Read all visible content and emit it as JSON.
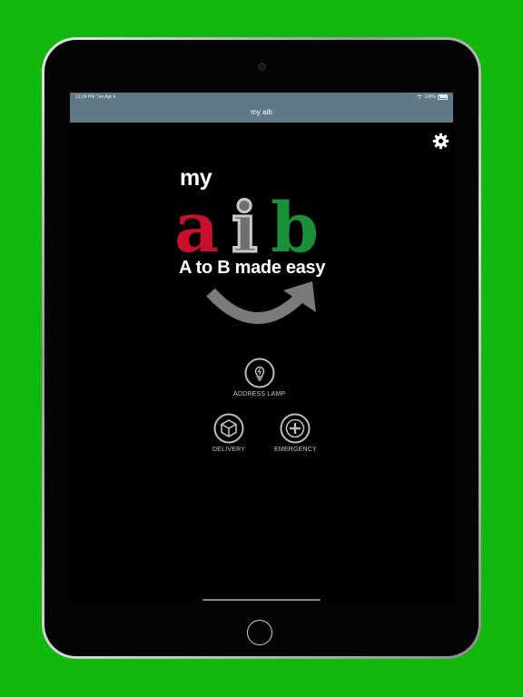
{
  "status_bar": {
    "time": "12:24 PM",
    "date": "Tue Apr 4",
    "battery": "100%"
  },
  "nav": {
    "title": "my aib"
  },
  "logo": {
    "my": "my",
    "letters": [
      "a",
      "i",
      "b"
    ],
    "tagline": "A to B made easy",
    "colors": {
      "a": "#c8102e",
      "i": "#b4b4b4",
      "b": "#1a8f3a",
      "arrow": "#7a7a7a"
    }
  },
  "menu": [
    {
      "label": "ADDRESS LAMP",
      "icon": "lightbulb-icon"
    },
    {
      "label": "DELIVERY",
      "icon": "package-icon"
    },
    {
      "label": "EMERGENCY",
      "icon": "plus-icon"
    }
  ],
  "settings": {
    "icon": "gear-icon"
  },
  "colors": {
    "background": "#13b80c",
    "navbar": "#5f7a84"
  }
}
